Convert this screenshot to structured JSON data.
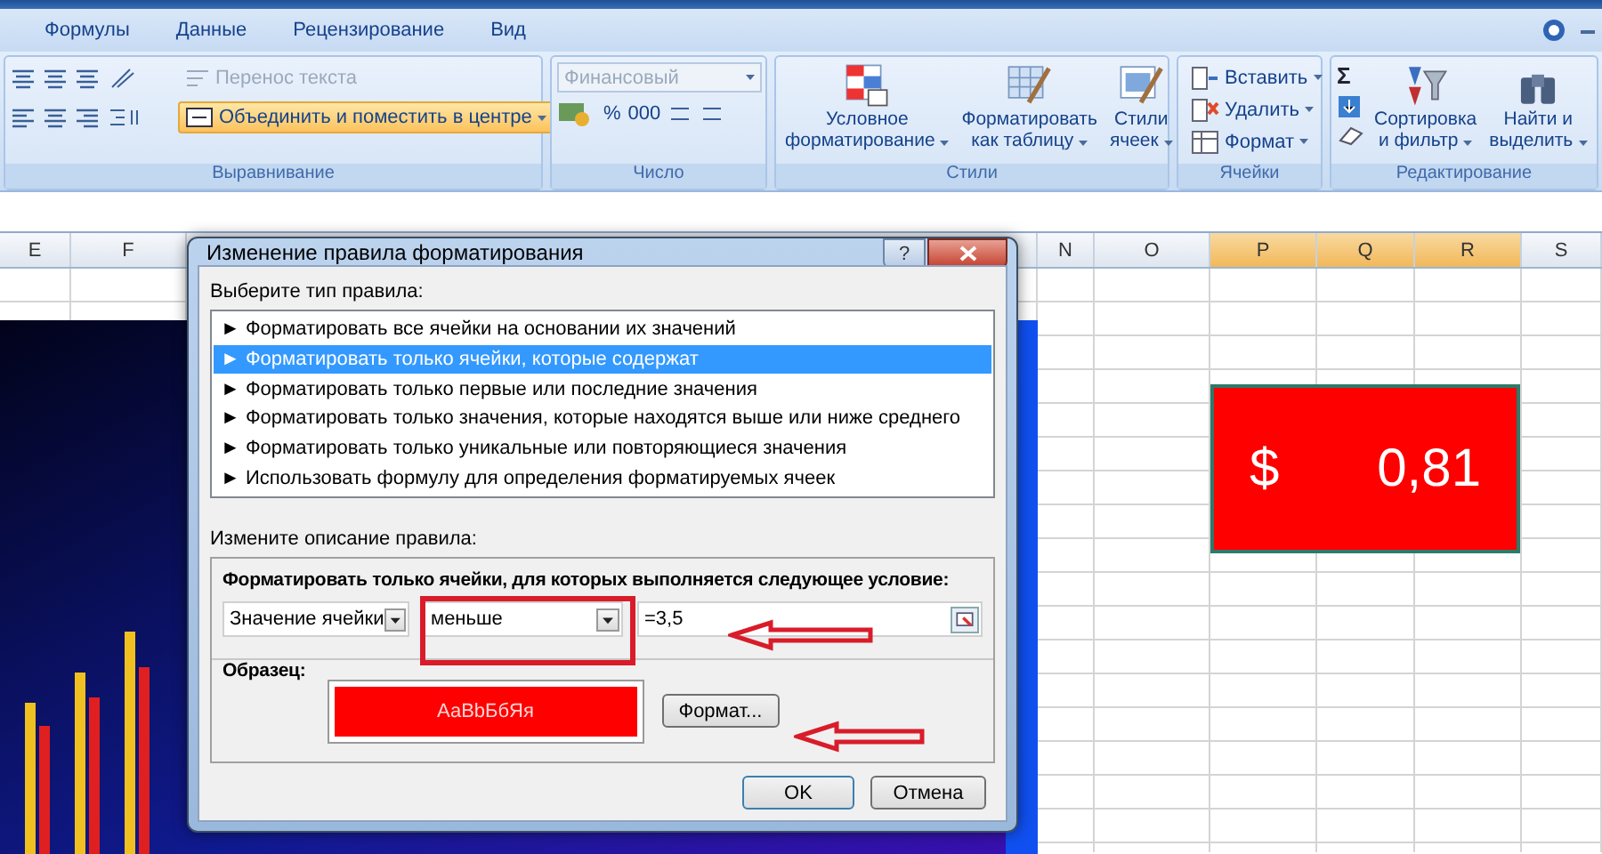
{
  "ribbon_tabs": [
    {
      "label": "Формулы"
    },
    {
      "label": "Данные"
    },
    {
      "label": "Рецензирование"
    },
    {
      "label": "Вид"
    }
  ],
  "ribbon": {
    "alignment": {
      "wrap_text": {
        "label": "Перенос текста",
        "disabled": true
      },
      "merge": {
        "label": "Объединить и поместить в центре",
        "highlighted": true
      },
      "label": "Выравнивание"
    },
    "number": {
      "format": {
        "value": "Финансовый",
        "disabled": true
      },
      "percent": "%",
      "thousands": "000",
      "label": "Число"
    },
    "styles": {
      "buttons": [
        {
          "lines": [
            "Условное",
            "форматирование"
          ],
          "kind": "conditional"
        },
        {
          "lines": [
            "Форматировать",
            "как таблицу"
          ],
          "kind": "table"
        },
        {
          "lines": [
            "Стили",
            "ячеек"
          ],
          "kind": "cellstyle"
        }
      ],
      "label": "Стили"
    },
    "cells": {
      "buttons": [
        {
          "label": "Вставить",
          "kind": "insert"
        },
        {
          "label": "Удалить",
          "kind": "delete"
        },
        {
          "label": "Формат",
          "kind": "format"
        }
      ],
      "label": "Ячейки"
    },
    "editing": {
      "sum": "Σ",
      "buttons": [
        {
          "lines": [
            "Сортировка",
            "и фильтр"
          ],
          "kind": "sort"
        },
        {
          "lines": [
            "Найти и",
            "выделить"
          ],
          "kind": "find"
        }
      ],
      "label": "Редактирование"
    }
  },
  "columns": [
    {
      "label": "E",
      "selected": false
    },
    {
      "label": "F",
      "selected": false
    },
    {
      "label": "N",
      "selected": false
    },
    {
      "label": "O",
      "selected": false
    },
    {
      "label": "P",
      "selected": true
    },
    {
      "label": "Q",
      "selected": true
    },
    {
      "label": "R",
      "selected": true
    },
    {
      "label": "S",
      "selected": false
    }
  ],
  "merged_cell": {
    "currency": "$",
    "value": "0,81"
  },
  "dialog": {
    "title": "Изменение правила форматирования",
    "help": "?",
    "rule_type_label": "Выберите тип правила:",
    "rule_types": [
      {
        "label": "► Форматировать все ячейки на основании их значений",
        "selected": false
      },
      {
        "label": "► Форматировать только ячейки, которые содержат",
        "selected": true
      },
      {
        "label": "► Форматировать только первые или последние значения",
        "selected": false
      },
      {
        "label": "► Форматировать только значения, которые находятся выше или ниже среднего",
        "selected": false
      },
      {
        "label": "► Форматировать только уникальные или повторяющиеся значения",
        "selected": false
      },
      {
        "label": "► Использовать формулу для определения форматируемых ячеек",
        "selected": false
      }
    ],
    "description_label": "Измените описание правила:",
    "condition_heading": "Форматировать только ячейки, для которых выполняется следующее условие:",
    "operand": "Значение ячейки",
    "operator": "меньше",
    "value": "=3,5",
    "preview_label": "Образец:",
    "preview_text": "АаBbБбЯя",
    "format_button": "Формат...",
    "ok_button": "OK",
    "cancel_button": "Отмена"
  }
}
